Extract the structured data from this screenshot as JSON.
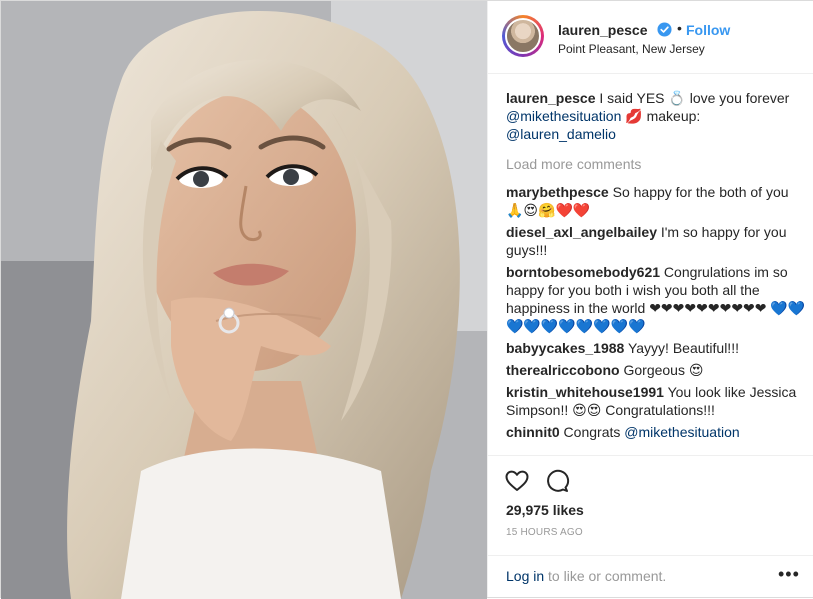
{
  "header": {
    "username": "lauren_pesce",
    "separator": "•",
    "follow_label": "Follow",
    "location": "Point Pleasant, New Jersey"
  },
  "caption": {
    "username": "lauren_pesce",
    "text_before": " I said YES 💍 love you forever ",
    "mention_1": "@mikethesituation",
    "text_middle": " 💋 makeup: ",
    "mention_2": "@lauren_damelio"
  },
  "load_more_label": "Load more comments",
  "comments": [
    {
      "user": "marybethpesce",
      "text": " So happy for the both of you 🙏😍🤗❤️❤️"
    },
    {
      "user": "diesel_axl_angelbailey",
      "text": " I'm so happy for you guys!!!"
    },
    {
      "user": "borntobesomebody621",
      "text": " Congrulations im so happy for you both i wish you both all the happiness in the world ❤❤❤❤❤❤❤❤❤❤ 💙💙💙💙💙💙💙💙💙💙"
    },
    {
      "user": "babyycakes_1988",
      "text": " Yayyy! Beautiful!!!"
    },
    {
      "user": "therealriccobono",
      "text": " Gorgeous 😍"
    },
    {
      "user": "kristin_whitehouse1991",
      "text": " You look like Jessica Simpson!! 😍😍 Congratulations!!!"
    },
    {
      "user": "chinnit0",
      "text": " Congrats ",
      "mention": "@mikethesituation"
    }
  ],
  "icons": {
    "verified": "verified-badge-icon",
    "like": "heart-icon",
    "comment": "comment-bubble-icon",
    "more": "more-options-icon"
  },
  "likes": "29,975 likes",
  "timestamp": "15 HOURS AGO",
  "login": {
    "link": "Log in",
    "rest": " to like or comment.",
    "more_glyph": "•••"
  },
  "colors": {
    "link_blue": "#3897f0",
    "mention_navy": "#003569",
    "muted_gray": "#999999"
  }
}
